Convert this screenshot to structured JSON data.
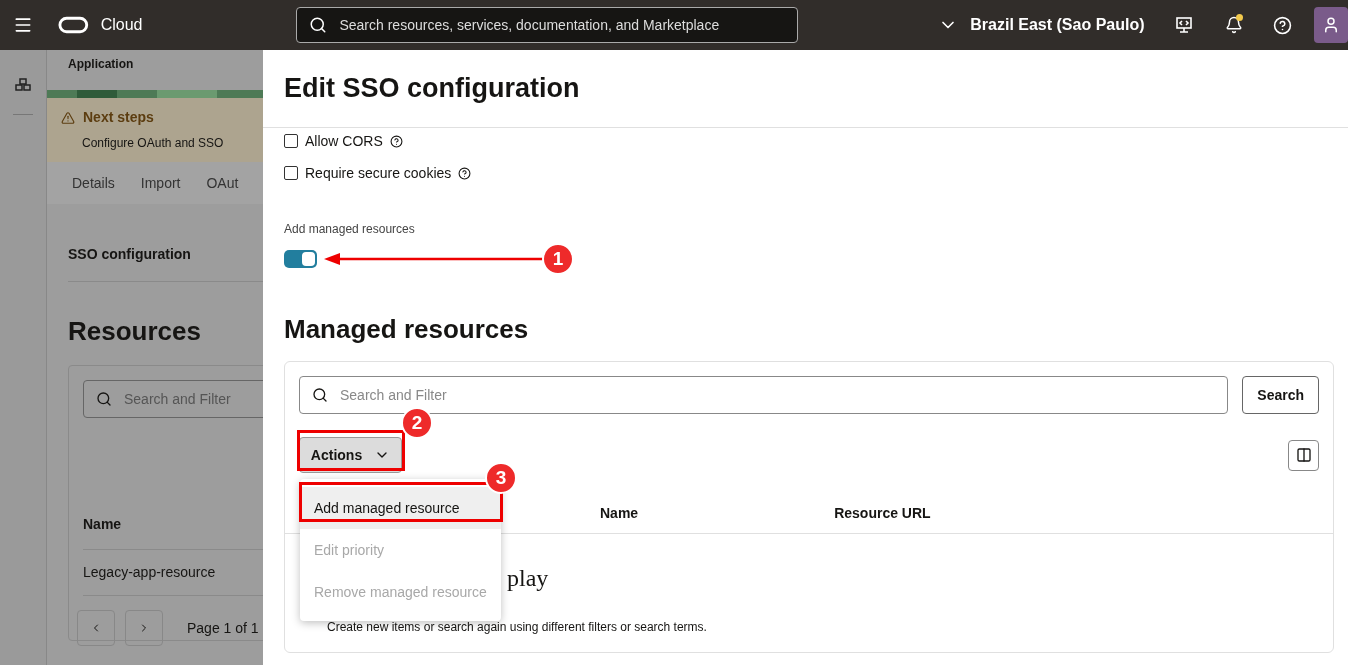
{
  "header": {
    "brand": "Cloud",
    "search_placeholder": "Search resources, services, documentation, and Marketplace",
    "region": "Brazil East (Sao Paulo)"
  },
  "background_page": {
    "breadcrumb": "Application",
    "next_steps": {
      "title": "Next steps",
      "text": "Configure OAuth and SSO"
    },
    "tabs": [
      {
        "label": "Details",
        "selected": false
      },
      {
        "label": "Import",
        "selected": false
      },
      {
        "label": "OAut",
        "selected": false
      }
    ],
    "section": "SSO configuration",
    "heading": "Resources",
    "search_placeholder": "Search and Filter",
    "column": "Name",
    "rows": [
      "Legacy-app-resource"
    ],
    "pagination": "Page 1 of 1"
  },
  "drawer": {
    "title": "Edit SSO configuration",
    "checkboxes": [
      {
        "label": "Allow CORS",
        "checked": false
      },
      {
        "label": "Require secure cookies",
        "checked": false
      }
    ],
    "toggle": {
      "label": "Add managed resources",
      "on": true
    },
    "managed": {
      "heading": "Managed resources",
      "search_placeholder": "Search and Filter",
      "search_button": "Search",
      "actions_button": "Actions",
      "menu": [
        {
          "label": "Add managed resource",
          "selected": true,
          "disabled": false
        },
        {
          "label": "Edit priority",
          "selected": false,
          "disabled": true
        },
        {
          "label": "Remove managed resource",
          "selected": false,
          "disabled": true
        }
      ],
      "columns": [
        "Name",
        "Resource URL"
      ],
      "empty_title": "play",
      "empty_text": "Create new items or search again using different filters or search terms."
    }
  },
  "annotations": [
    "1",
    "2",
    "3"
  ]
}
